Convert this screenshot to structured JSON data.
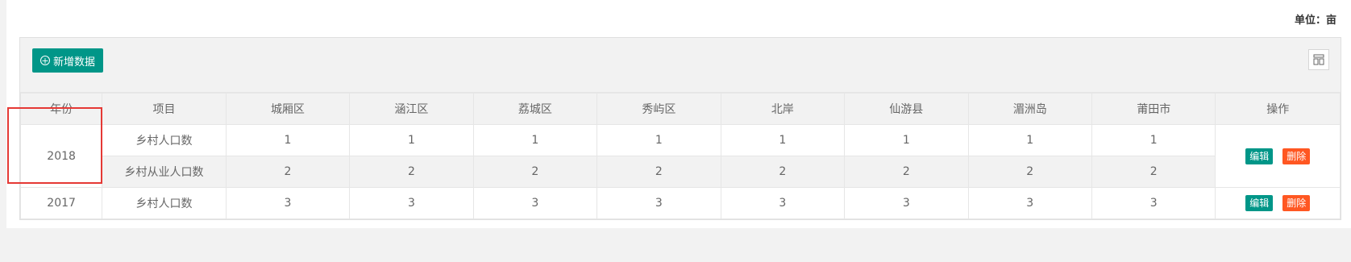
{
  "unit_label": "单位：亩",
  "toolbar": {
    "add_label": "新增数据",
    "add_icon": "plus-circle-icon",
    "columns_icon": "columns-grid-icon"
  },
  "table": {
    "headers": [
      "年份",
      "项目",
      "城厢区",
      "涵江区",
      "荔城区",
      "秀屿区",
      "北岸",
      "仙游县",
      "湄洲岛",
      "莆田市",
      "操作"
    ],
    "groups": [
      {
        "year": "2018",
        "rows": [
          {
            "item": "乡村人口数",
            "values": [
              "1",
              "1",
              "1",
              "1",
              "1",
              "1",
              "1",
              "1"
            ]
          },
          {
            "item": "乡村从业人口数",
            "values": [
              "2",
              "2",
              "2",
              "2",
              "2",
              "2",
              "2",
              "2"
            ]
          }
        ]
      },
      {
        "year": "2017",
        "rows": [
          {
            "item": "乡村人口数",
            "values": [
              "3",
              "3",
              "3",
              "3",
              "3",
              "3",
              "3",
              "3"
            ]
          }
        ]
      }
    ],
    "edit_label": "编辑",
    "delete_label": "删除"
  },
  "colors": {
    "primary": "#009688",
    "danger": "#FF5722",
    "highlight": "#e53935"
  }
}
